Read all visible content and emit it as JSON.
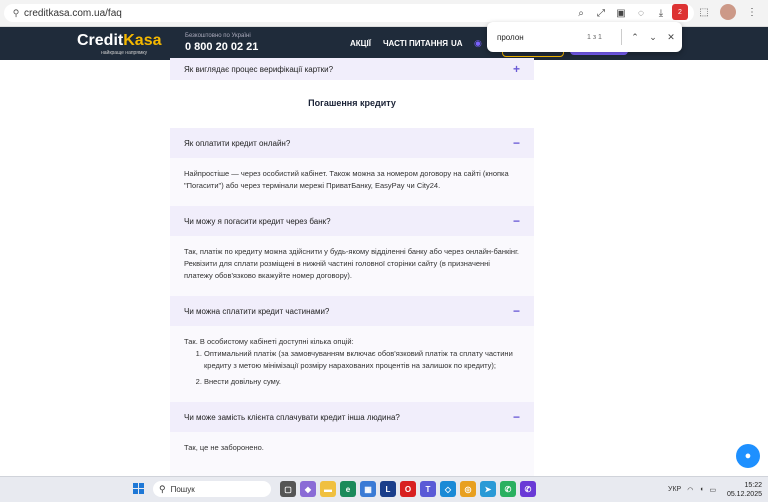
{
  "browser": {
    "url": "creditkasa.com.ua/faq"
  },
  "site_header": {
    "logo_credit": "Credit",
    "logo_kasa": "Kasa",
    "logo_sub": "найкраще напрямку",
    "free_label": "Безкоштовно по Україні",
    "phone": "0 800 20 02 21",
    "nav": [
      "АКЦІЇ",
      "ЧАСТІ ПИТАННЯ"
    ],
    "lang": "UA"
  },
  "find_bar": {
    "query": "пролон",
    "count": "1 з 1"
  },
  "faq": {
    "prev_question": "Як виглядає процес верифікації картки?",
    "section_title": "Погашення кредиту",
    "items": [
      {
        "question": "Як оплатити кредит онлайн?",
        "answer": "Найпростіше — через особистий кабінет. Також можна за номером договору на сайті (кнопка \"Погасити\") або через термінали мережі ПриватБанку, EasyPay чи City24."
      },
      {
        "question": "Чи можу я погасити кредит через банк?",
        "answer": "Так, платіж по кредиту можна здійснити у будь-якому відділенні банку або через онлайн-банкінг. Реквізити для сплати розміщені в нижній частині головної сторінки сайту (в призначенні платежу обов'язково вкажуйте номер договору)."
      },
      {
        "question": "Чи можна сплатити кредит частинами?",
        "answer_intro": "Так. В особистому кабінеті доступні кілька опцій:",
        "answer_list": [
          "Оптимальний платіж (за замовчуванням включає обов'язковий платіж та сплату частини кредиту з метою мінімізації розміру нарахованих процентів на залишок по кредиту);",
          "Внести довільну суму."
        ]
      },
      {
        "question": "Чи може замість клієнта сплачувати кредит інша людина?",
        "answer": "Так, це не заборонено."
      }
    ]
  },
  "taskbar": {
    "search": "Пошук",
    "lang": "УКР",
    "time": "15:22",
    "date": "05.12.2025"
  }
}
